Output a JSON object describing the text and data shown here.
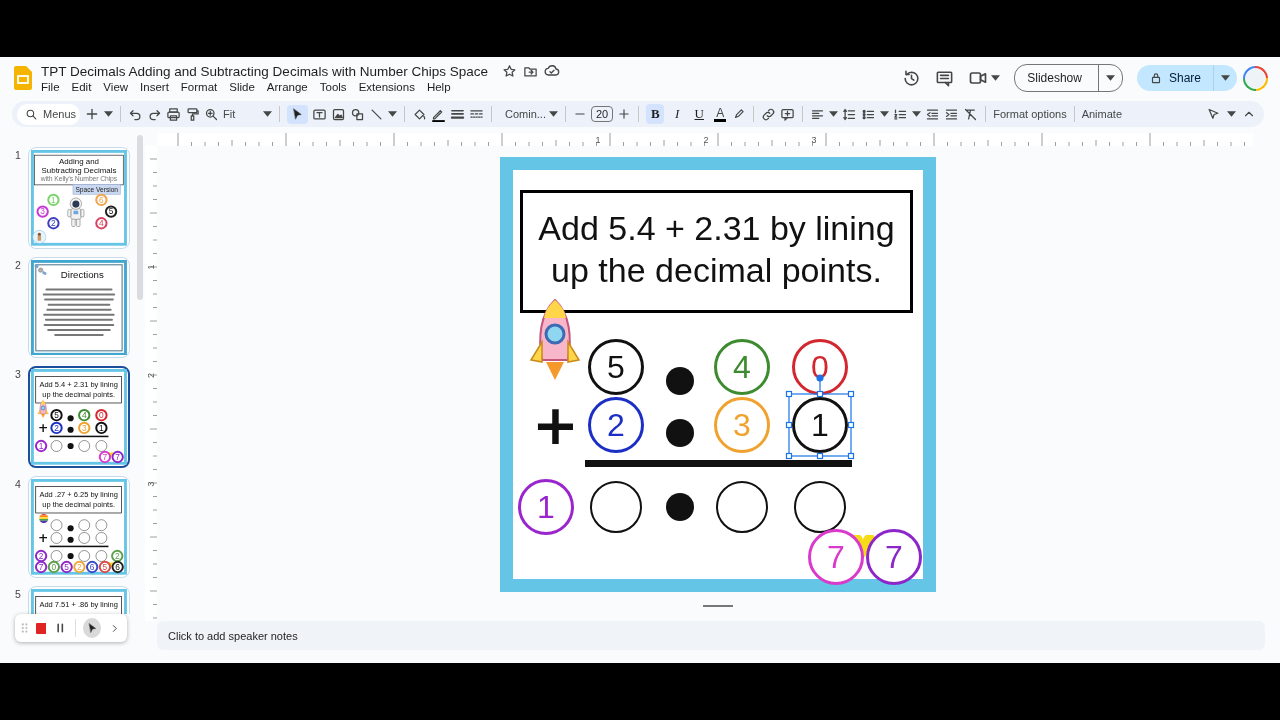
{
  "app": {
    "title": "TPT Decimals Adding and Subtracting Decimals with Number Chips Space",
    "menu": [
      "File",
      "Edit",
      "View",
      "Insert",
      "Format",
      "Slide",
      "Arrange",
      "Tools",
      "Extensions",
      "Help"
    ],
    "slideshow": "Slideshow",
    "share": "Share"
  },
  "toolbar": {
    "search_placeholder": "Menus",
    "zoom": "Fit",
    "select_tool_selected": true,
    "font": "Comin...",
    "font_size": "20",
    "text_styles": [
      {
        "label": "B",
        "selected": true
      },
      {
        "label": "I",
        "selected": false
      },
      {
        "label": "U",
        "selected": false
      }
    ],
    "text_color": "A",
    "format_options": "Format options",
    "animate": "Animate"
  },
  "ruler": {
    "horizontal": [
      "1",
      "2",
      "3"
    ],
    "vertical": [
      "1",
      "2",
      "3"
    ]
  },
  "filmstrip": [
    {
      "number": "1",
      "selected": false,
      "slide": {
        "kind": "title",
        "heading": "Adding and Subtracting Decimals",
        "subtitle": "with Kelly's Number Chips",
        "badge": "Space Version",
        "chips": [
          {
            "digit": "1",
            "color": "#7ad46a"
          },
          {
            "digit": "3",
            "color": "#c83ad6"
          },
          {
            "digit": "2",
            "color": "#3b3cc0"
          },
          {
            "digit": "6",
            "color": "#f2a44a"
          },
          {
            "digit": "5",
            "color": "#222222"
          },
          {
            "digit": "4",
            "color": "#d84060"
          }
        ]
      }
    },
    {
      "number": "2",
      "selected": false,
      "slide": {
        "kind": "directions",
        "heading": "Directions"
      }
    },
    {
      "number": "3",
      "selected": true,
      "slide": {
        "kind": "problem",
        "title": "Add 5.4 + 2.31 by lining up the decimal points.",
        "rows": [
          {
            "cells": [
              {
                "kind": "rocket"
              },
              {
                "kind": "chip",
                "digit": "5",
                "color": "#111111"
              },
              {
                "kind": "dot"
              },
              {
                "kind": "chip",
                "digit": "4",
                "color": "#3d8b2f"
              },
              {
                "kind": "chip",
                "digit": "0",
                "color": "#d3262e"
              }
            ]
          },
          {
            "cells": [
              {
                "kind": "sign",
                "text": "+"
              },
              {
                "kind": "chip",
                "digit": "2",
                "color": "#1b2fc4"
              },
              {
                "kind": "dot"
              },
              {
                "kind": "chip",
                "digit": "3",
                "color": "#f0a22e"
              },
              {
                "kind": "chip",
                "digit": "1",
                "color": "#111111"
              }
            ]
          },
          {
            "cells": [
              {
                "kind": "chip",
                "digit": "1",
                "color": "#9b25cc"
              },
              {
                "kind": "blank"
              },
              {
                "kind": "dot"
              },
              {
                "kind": "blank"
              },
              {
                "kind": "blank"
              }
            ]
          }
        ],
        "extras": [
          {
            "digit": "7",
            "color": "#d93acb"
          },
          {
            "digit": "7",
            "color": "#8d26c9"
          }
        ]
      }
    },
    {
      "number": "4",
      "selected": false,
      "slide": {
        "kind": "problem",
        "title": "Add .27 + 6.25 by lining up the decimal points.",
        "rows": [
          {
            "cells": [
              {
                "kind": "ball"
              },
              {
                "kind": "blank"
              },
              {
                "kind": "dot"
              },
              {
                "kind": "blank"
              },
              {
                "kind": "blank"
              }
            ]
          },
          {
            "cells": [
              {
                "kind": "sign",
                "text": "+"
              },
              {
                "kind": "blank"
              },
              {
                "kind": "dot"
              },
              {
                "kind": "blank"
              },
              {
                "kind": "blank"
              }
            ]
          },
          {
            "cells": [
              {
                "kind": "chip",
                "digit": "2",
                "color": "#8f27c9"
              },
              {
                "kind": "blank"
              },
              {
                "kind": "dot"
              },
              {
                "kind": "blank"
              },
              {
                "kind": "blank"
              },
              {
                "kind": "chip",
                "digit": "2",
                "color": "#5aa04a"
              }
            ]
          }
        ],
        "extras": [
          {
            "digit": "7",
            "color": "#8f27c9"
          },
          {
            "digit": "0",
            "color": "#5aa04a"
          },
          {
            "digit": "5",
            "color": "#8f27c9"
          },
          {
            "digit": "2",
            "color": "#f0a63a"
          },
          {
            "digit": "6",
            "color": "#3949c9"
          },
          {
            "digit": "5",
            "color": "#d84a4a"
          },
          {
            "digit": "6",
            "color": "#222222"
          }
        ]
      }
    },
    {
      "number": "5",
      "selected": false,
      "slide": {
        "kind": "problem",
        "title": "Add 7.51 + .86 by lining"
      }
    }
  ],
  "canvas": {
    "slide": {
      "kind": "problem",
      "title": "Add 5.4 + 2.31 by lining up the decimal points.",
      "rows": [
        {
          "cells": [
            {
              "kind": "rocket"
            },
            {
              "kind": "chip",
              "digit": "5",
              "color": "#111111",
              "selected": false
            },
            {
              "kind": "dot"
            },
            {
              "kind": "chip",
              "digit": "4",
              "color": "#3d8b2f",
              "selected": false
            },
            {
              "kind": "chip",
              "digit": "0",
              "color": "#d3262e",
              "selected": false
            }
          ]
        },
        {
          "cells": [
            {
              "kind": "sign",
              "text": "+"
            },
            {
              "kind": "chip",
              "digit": "2",
              "color": "#1b2fc4",
              "selected": false
            },
            {
              "kind": "dot"
            },
            {
              "kind": "chip",
              "digit": "3",
              "color": "#f0a22e",
              "selected": false
            },
            {
              "kind": "chip",
              "digit": "1",
              "color": "#111111",
              "selected": true
            }
          ]
        },
        {
          "cells": [
            {
              "kind": "chip",
              "digit": "1",
              "color": "#9b25cc",
              "selected": false
            },
            {
              "kind": "blank"
            },
            {
              "kind": "dot"
            },
            {
              "kind": "blank"
            },
            {
              "kind": "blank"
            }
          ]
        }
      ],
      "extras": [
        {
          "digit": "7",
          "color": "#d93acb",
          "selected": false
        },
        {
          "digit": "7",
          "color": "#8d26c9",
          "selected": false
        }
      ]
    }
  },
  "speaker_notes": {
    "placeholder": "Click to add speaker notes"
  }
}
